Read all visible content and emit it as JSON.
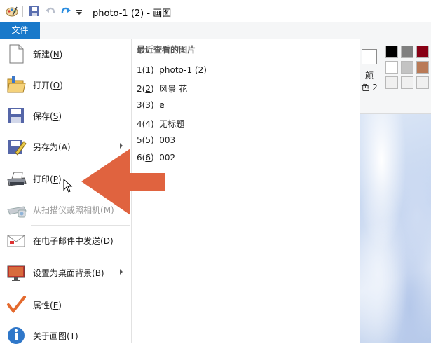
{
  "window": {
    "title": "photo-1 (2) - 画图",
    "file_tab": "文件"
  },
  "ribbon": {
    "color_label": "颜\n色 2",
    "palette": [
      "#000000",
      "#7f7f7f",
      "#880015",
      "#ffffff",
      "#c3c3c3",
      "#b97a57",
      "#f0f0f0",
      "#f0f0f0",
      "#f0f0f0"
    ]
  },
  "menu": {
    "items": [
      {
        "label": "新建",
        "key": "N",
        "icon": "new-file-icon",
        "disabled": false,
        "submenu": false
      },
      {
        "label": "打开",
        "key": "O",
        "icon": "open-folder-icon",
        "disabled": false,
        "submenu": false
      },
      {
        "label": "保存",
        "key": "S",
        "icon": "save-icon",
        "disabled": false,
        "submenu": false
      },
      {
        "label": "另存为",
        "key": "A",
        "icon": "save-as-icon",
        "disabled": false,
        "submenu": true
      },
      {
        "label": "打印",
        "key": "P",
        "icon": "printer-icon",
        "disabled": false,
        "submenu": true
      },
      {
        "label": "从扫描仪或照相机",
        "key": "M",
        "icon": "scanner-icon",
        "disabled": true,
        "submenu": false
      },
      {
        "label": "在电子邮件中发送",
        "key": "D",
        "icon": "email-icon",
        "disabled": false,
        "submenu": false
      },
      {
        "label": "设置为桌面背景",
        "key": "B",
        "icon": "desktop-background-icon",
        "disabled": false,
        "submenu": true
      },
      {
        "label": "属性",
        "key": "E",
        "icon": "properties-check-icon",
        "disabled": false,
        "submenu": false
      },
      {
        "label": "关于画图",
        "key": "T",
        "icon": "info-icon",
        "disabled": false,
        "submenu": false
      }
    ],
    "recent_heading": "最近查看的图片",
    "recent": [
      {
        "num": "1",
        "key": "1",
        "name": "photo-1 (2)"
      },
      {
        "num": "2",
        "key": "2",
        "name": "风景 花"
      },
      {
        "num": "3",
        "key": "3",
        "name": "e"
      },
      {
        "num": "4",
        "key": "4",
        "name": "无标题"
      },
      {
        "num": "5",
        "key": "5",
        "name": "003"
      },
      {
        "num": "6",
        "key": "6",
        "name": "002"
      }
    ]
  },
  "annotation": {
    "arrow_color": "#e0633f"
  }
}
